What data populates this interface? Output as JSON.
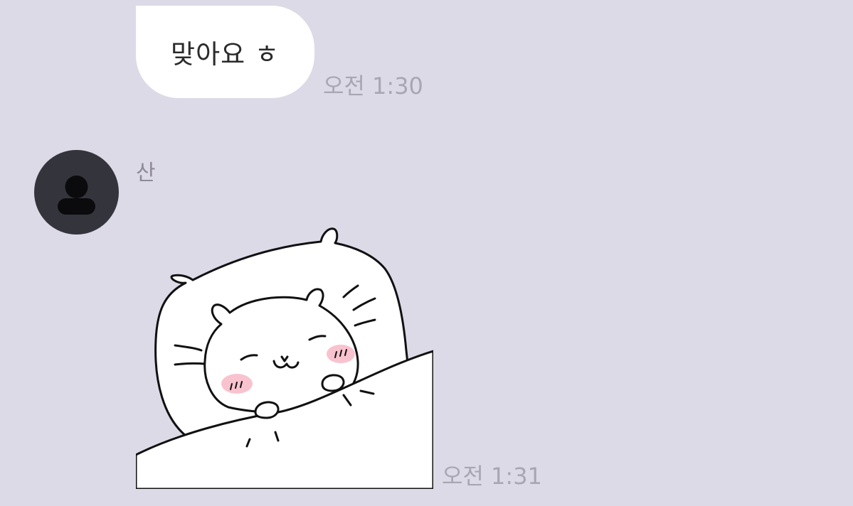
{
  "chat": {
    "bg_color": "#dddae8",
    "messages": [
      {
        "type": "text",
        "text": "맞아요 ㅎ",
        "time": "오전 1:30"
      },
      {
        "type": "sticker",
        "sender": "산",
        "avatar_icon": "default-person-icon",
        "sticker_icon": "sleeping-cat-sticker",
        "time": "오전 1:31"
      }
    ]
  }
}
